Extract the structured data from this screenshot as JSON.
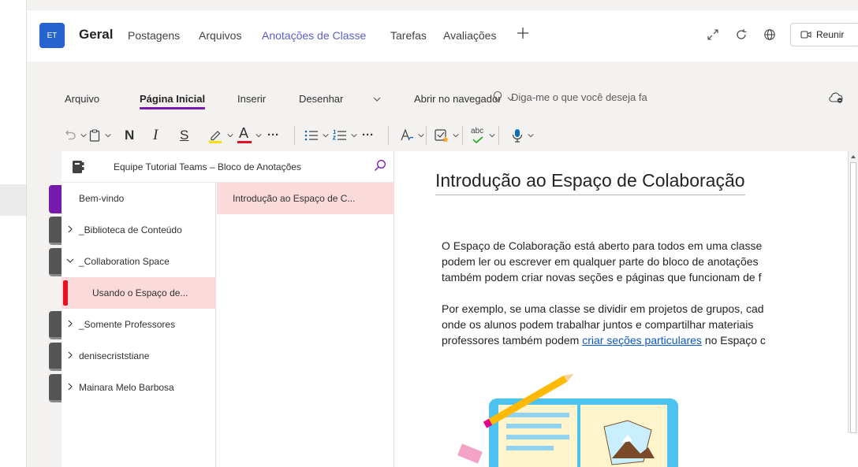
{
  "teams_header": {
    "avatar_initials": "ET",
    "channel_name": "Geral",
    "tabs": [
      {
        "label": "Postagens"
      },
      {
        "label": "Arquivos"
      },
      {
        "label": "Anotações de Classe",
        "active": true
      },
      {
        "label": "Tarefas"
      },
      {
        "label": "Avaliações"
      }
    ],
    "add_tab_icon": "plus-icon",
    "right_icons": [
      "expand-icon",
      "refresh-icon",
      "globe-icon"
    ],
    "meet_button_label": "Reunir",
    "accent_color": "#5b5fc7"
  },
  "ribbon": {
    "tabs": [
      {
        "label": "Arquivo"
      },
      {
        "label": "Página Inicial",
        "active": true
      },
      {
        "label": "Inserir"
      },
      {
        "label": "Desenhar"
      }
    ],
    "open_in_browser": "Abrir no navegador",
    "tell_me_placeholder": "Diga-me o que você deseja fa",
    "active_tab_color": "#7719aa",
    "toolbar": {
      "bold": "N",
      "italic": "I",
      "strikethrough": "S",
      "font_color_letter": "A",
      "more": "···",
      "spellcheck_label": "abc",
      "icons": [
        "undo-icon",
        "clipboard-icon",
        "highlighter-icon",
        "font-color-icon",
        "bullets-icon",
        "numbering-icon",
        "styles-icon",
        "tag-icon",
        "spelling-icon",
        "dictate-icon"
      ]
    }
  },
  "notebook": {
    "title": "Equipe Tutorial Teams – Bloco de Anotações",
    "sections": [
      {
        "label": "Bem-vindo",
        "expandable": false
      },
      {
        "label": "_Biblioteca de Conteúdo",
        "expandable": true,
        "expanded": false
      },
      {
        "label": "_Collaboration Space",
        "expandable": true,
        "expanded": true
      },
      {
        "label": "Usando o Espaço de...",
        "child": true,
        "selected": true
      },
      {
        "label": "_Somente Professores",
        "expandable": true,
        "expanded": false
      },
      {
        "label": "denisecriststiane",
        "expandable": true,
        "expanded": false
      },
      {
        "label": "Mainara Melo Barbosa",
        "expandable": true,
        "expanded": false
      }
    ],
    "pages": [
      {
        "label": "Introdução ao Espaço de C...",
        "selected": true
      }
    ],
    "section_tab_colors": [
      "#7719aa",
      "#555555",
      "#555555",
      "#555555",
      "#555555",
      "#555555"
    ],
    "selected_color": "#fbdadc",
    "marker_color": "#e81123"
  },
  "page": {
    "title": "Introdução ao Espaço de Colaboração",
    "para1": [
      "O Espaço de Colaboração está aberto para todos em uma classe",
      "podem ler ou escrever em qualquer parte do bloco de anotações",
      "também podem criar novas seções e páginas que funcionam de f"
    ],
    "para2_lines": [
      "Por exemplo, se uma classe se dividir em projetos de grupos, cad",
      "onde os alunos podem trabalhar juntos e compartilhar materiais"
    ],
    "para2_last_before": "professores também podem ",
    "para2_link": "criar seções particulares",
    "para2_last_after": " no Espaço c"
  }
}
